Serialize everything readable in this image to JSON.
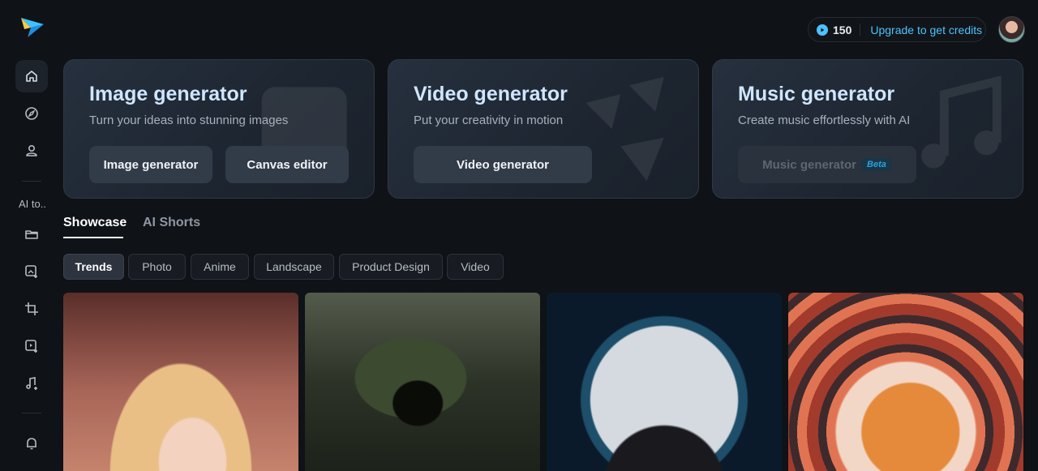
{
  "header": {
    "credits": "150",
    "upgrade_label": "Upgrade to get credits"
  },
  "sidebar": {
    "items": [
      {
        "icon": "home-icon"
      },
      {
        "icon": "compass-icon"
      },
      {
        "icon": "user-icon"
      },
      {
        "icon": "folder-icon"
      },
      {
        "icon": "image-sparkle-icon"
      },
      {
        "icon": "crop-icon"
      },
      {
        "icon": "video-sparkle-icon"
      },
      {
        "icon": "music-sparkle-icon"
      },
      {
        "icon": "bell-icon"
      }
    ],
    "ai_tools_label": "AI to.."
  },
  "generators": [
    {
      "title": "Image generator",
      "subtitle": "Turn your ideas into stunning images",
      "buttons": [
        "Image generator",
        "Canvas editor"
      ]
    },
    {
      "title": "Video generator",
      "subtitle": "Put your creativity in motion",
      "buttons": [
        "Video generator"
      ]
    },
    {
      "title": "Music generator",
      "subtitle": "Create music effortlessly with AI",
      "buttons": [
        "Music generator"
      ],
      "badge": "Beta"
    }
  ],
  "tabs": [
    "Showcase",
    "AI Shorts"
  ],
  "filters": [
    "Trends",
    "Photo",
    "Anime",
    "Landscape",
    "Product Design",
    "Video"
  ],
  "colors": {
    "accent": "#4cc2ff",
    "background": "#0f1216"
  }
}
